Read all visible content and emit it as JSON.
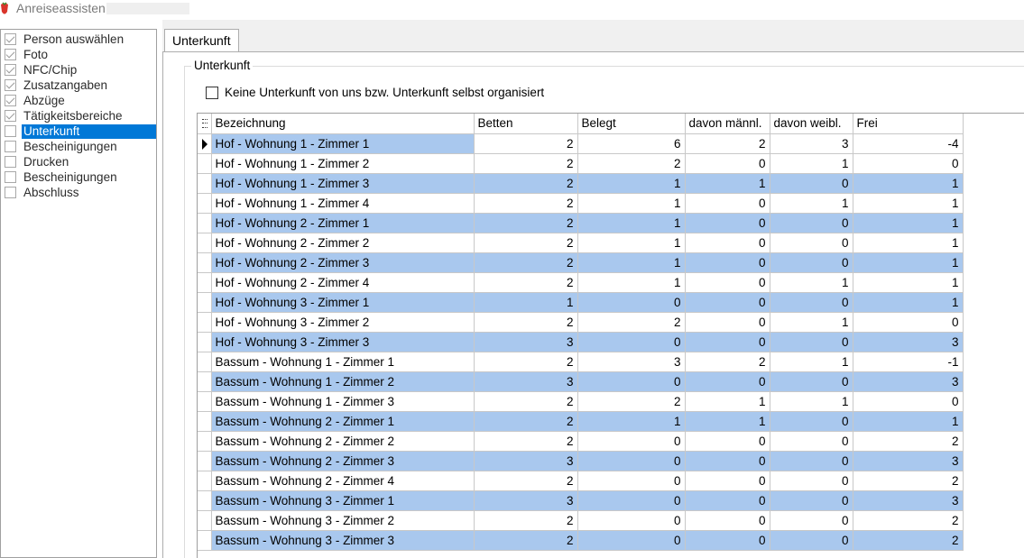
{
  "window": {
    "title": "Anreiseassisten"
  },
  "sidebar": {
    "items": [
      {
        "label": "Person auswählen",
        "checked": true
      },
      {
        "label": "Foto",
        "checked": true
      },
      {
        "label": "NFC/Chip",
        "checked": true
      },
      {
        "label": "Zusatzangaben",
        "checked": true
      },
      {
        "label": "Abzüge",
        "checked": true
      },
      {
        "label": "Tätigkeitsbereiche",
        "checked": true
      },
      {
        "label": "Unterkunft",
        "checked": false,
        "selected": true
      },
      {
        "label": "Bescheinigungen",
        "checked": false
      },
      {
        "label": "Drucken",
        "checked": false
      },
      {
        "label": "Bescheinigungen",
        "checked": false
      },
      {
        "label": "Abschluss",
        "checked": false
      }
    ]
  },
  "tab": {
    "label": "Unterkunft"
  },
  "group": {
    "title": "Unterkunft"
  },
  "option": {
    "label": "Keine Unterkunft von uns bzw. Unterkunft selbst organisiert",
    "checked": false
  },
  "grid": {
    "columns": [
      "Bezeichnung",
      "Betten",
      "Belegt",
      "davon männl.",
      "davon weibl.",
      "Frei"
    ],
    "rows": [
      [
        "Hof - Wohnung 1 - Zimmer 1",
        "2",
        "6",
        "2",
        "3",
        "-4"
      ],
      [
        "Hof - Wohnung 1 - Zimmer 2",
        "2",
        "2",
        "0",
        "1",
        "0"
      ],
      [
        "Hof - Wohnung 1 - Zimmer 3",
        "2",
        "1",
        "1",
        "0",
        "1"
      ],
      [
        "Hof - Wohnung 1 - Zimmer 4",
        "2",
        "1",
        "0",
        "1",
        "1"
      ],
      [
        "Hof - Wohnung 2 - Zimmer 1",
        "2",
        "1",
        "0",
        "0",
        "1"
      ],
      [
        "Hof - Wohnung 2 - Zimmer 2",
        "2",
        "1",
        "0",
        "0",
        "1"
      ],
      [
        "Hof - Wohnung 2 - Zimmer 3",
        "2",
        "1",
        "0",
        "0",
        "1"
      ],
      [
        "Hof - Wohnung 2 - Zimmer 4",
        "2",
        "1",
        "0",
        "1",
        "1"
      ],
      [
        "Hof - Wohnung 3 - Zimmer 1",
        "1",
        "0",
        "0",
        "0",
        "1"
      ],
      [
        "Hof - Wohnung 3 - Zimmer 2",
        "2",
        "2",
        "0",
        "1",
        "0"
      ],
      [
        "Hof - Wohnung 3 - Zimmer 3",
        "3",
        "0",
        "0",
        "0",
        "3"
      ],
      [
        "Bassum - Wohnung 1 - Zimmer 1",
        "2",
        "3",
        "2",
        "1",
        "-1"
      ],
      [
        "Bassum - Wohnung 1 - Zimmer 2",
        "3",
        "0",
        "0",
        "0",
        "3"
      ],
      [
        "Bassum - Wohnung 1 - Zimmer 3",
        "2",
        "2",
        "1",
        "1",
        "0"
      ],
      [
        "Bassum - Wohnung 2 - Zimmer 1",
        "2",
        "1",
        "1",
        "0",
        "1"
      ],
      [
        "Bassum - Wohnung 2 - Zimmer 2",
        "2",
        "0",
        "0",
        "0",
        "2"
      ],
      [
        "Bassum - Wohnung 2 - Zimmer 3",
        "3",
        "0",
        "0",
        "0",
        "3"
      ],
      [
        "Bassum - Wohnung 2 - Zimmer 4",
        "2",
        "0",
        "0",
        "0",
        "2"
      ],
      [
        "Bassum -  Wohnung 3 - Zimmer 1",
        "3",
        "0",
        "0",
        "0",
        "3"
      ],
      [
        "Bassum -  Wohnung 3 - Zimmer 2",
        "2",
        "0",
        "0",
        "0",
        "2"
      ],
      [
        "Bassum - Wohnung 3 -  Zimmer 3",
        "2",
        "0",
        "0",
        "0",
        "2"
      ]
    ]
  },
  "colors": {
    "selection": "#0078d7",
    "alt_row": "#a9c8ee"
  }
}
